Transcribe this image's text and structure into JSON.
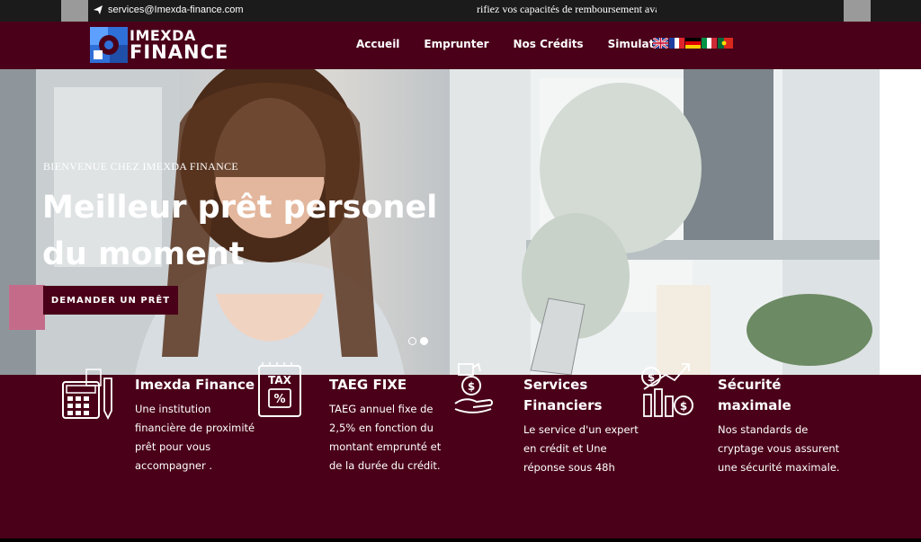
{
  "topbar": {
    "email": "services@Imexda-finance.com",
    "ticker": "rifiez vos capacités de remboursement avar"
  },
  "header": {
    "logo_line1": "IMEXDA",
    "logo_line2": "FINANCE",
    "nav": [
      "Accueil",
      "Emprunter",
      "Nos Crédits",
      "Simulateur"
    ],
    "flags": [
      "uk-flag",
      "fr-flag",
      "de-flag",
      "it-flag",
      "pt-flag"
    ]
  },
  "hero": {
    "subtitle": "BIENVENUE CHEZ IMEXDA FINANCE",
    "title": "Meilleur prêt personel du moment",
    "button": "DEMANDER UN PRÊT",
    "slides_active": 2,
    "slides_total": 2
  },
  "features": [
    {
      "icon": "calculator-icon",
      "title": "Imexda Finance",
      "text": "Une institution financière de proximité prêt pour vous accompagner ."
    },
    {
      "icon": "tax-icon",
      "title": "TAEG FIXE",
      "text": "TAEG annuel fixe de 2,5% en fonction du montant emprunté et de la durée du crédit."
    },
    {
      "icon": "money-hand-icon",
      "title": "Services Financiers",
      "text": "Le service d'un expert en crédit et Une réponse sous 48h"
    },
    {
      "icon": "growth-chart-icon",
      "title": "Sécurité maximale",
      "text": "Nos standards de cryptage vous assurent une sécurité maximale."
    }
  ],
  "colors": {
    "brand": "#4a0019",
    "topbar": "#1b1b1b"
  }
}
